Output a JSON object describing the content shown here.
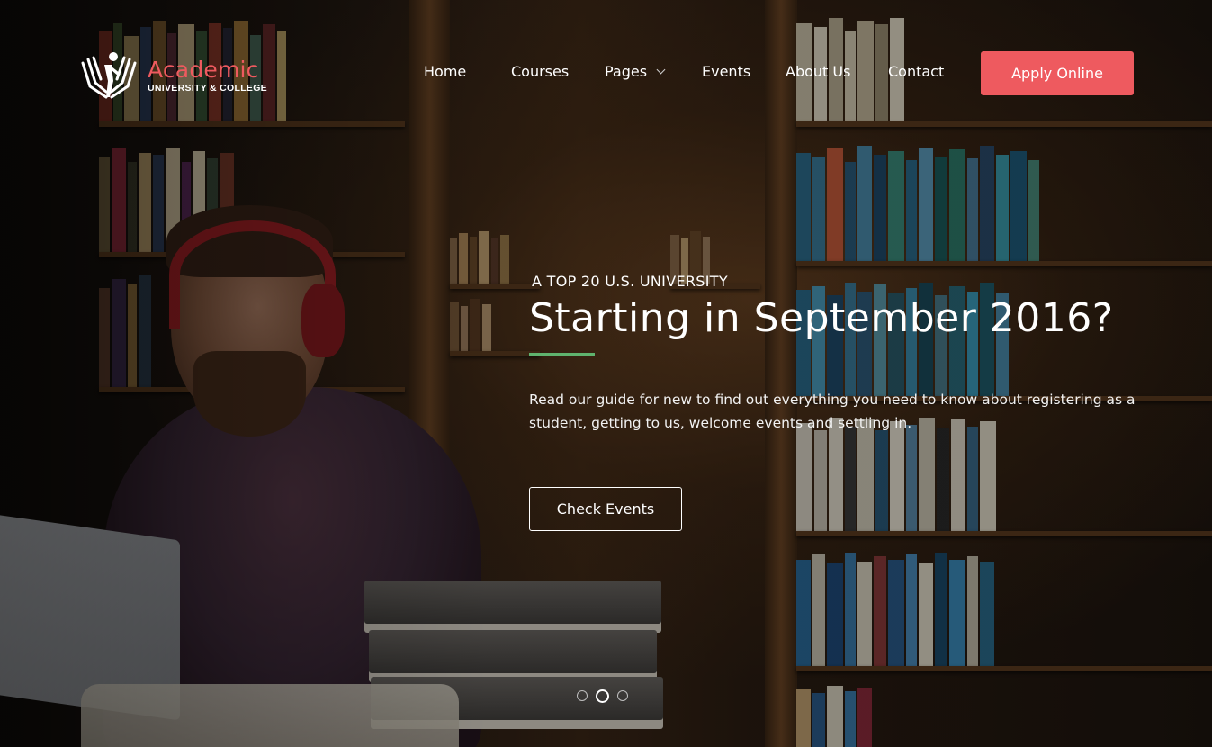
{
  "brand": {
    "title": "Academic",
    "subtitle": "UNIVERSITY & COLLEGE",
    "logo_icon": "open-book-person-icon",
    "accent_color": "#ee5a5f"
  },
  "nav": {
    "items": [
      {
        "label": "Home"
      },
      {
        "label": "Courses"
      },
      {
        "label": "Pages",
        "has_dropdown": true
      },
      {
        "label": "Events"
      },
      {
        "label": "About Us"
      },
      {
        "label": "Contact"
      }
    ],
    "cta_label": "Apply Online"
  },
  "hero": {
    "eyebrow": "A TOP 20 U.S. UNIVERSITY",
    "headline": "Starting in September 2016?",
    "description": "Read our guide for new to find out everything you need to know about registering as a student, getting to us, welcome events and settling in.",
    "button_label": "Check Events",
    "accent_line_color": "#5fb36e"
  },
  "carousel": {
    "slide_count": 3,
    "active_index": 1
  }
}
